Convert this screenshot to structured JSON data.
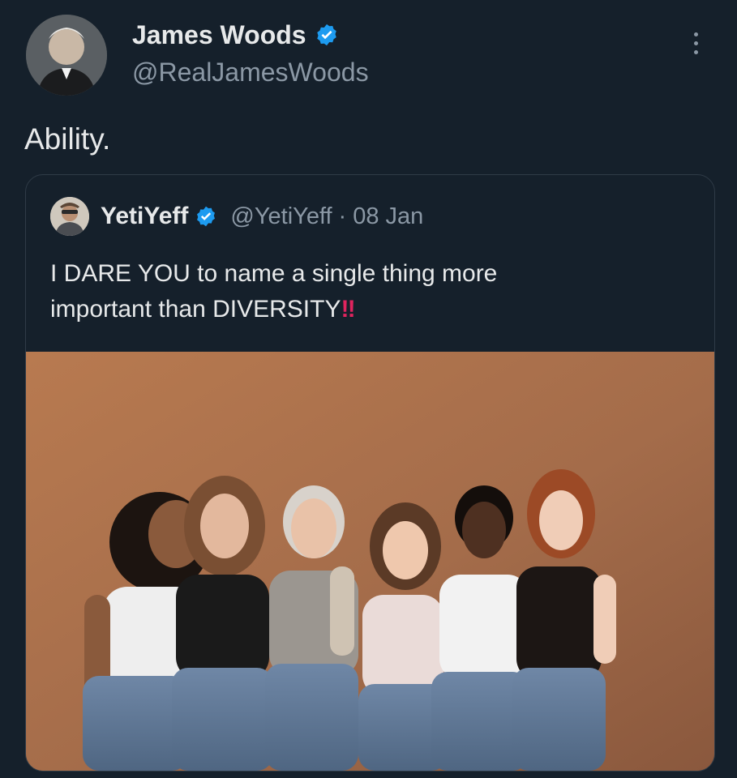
{
  "tweet": {
    "author": {
      "name": "James Woods",
      "handle": "@RealJamesWoods",
      "verified": true,
      "avatar_icon": "profile-photo"
    },
    "text": "Ability.",
    "more_icon": "more-vertical-icon"
  },
  "quote": {
    "author": {
      "name": "YetiYeff",
      "handle": "@YetiYeff",
      "verified": true,
      "avatar_icon": "profile-photo"
    },
    "separator": "·",
    "date": "08 Jan",
    "text_line1": "I DARE YOU to name a single thing more",
    "text_line2": "important than DIVERSITY",
    "emoji": "‼",
    "media": {
      "type": "photo",
      "subject_icon": "group-photo-six-women"
    }
  },
  "colors": {
    "background": "#15202b",
    "text_primary": "#e7e9ea",
    "text_secondary": "#8b98a5",
    "verified_blue": "#1d9bf0",
    "emoji_red": "#e0245e",
    "card_border": "#2f3b47"
  }
}
